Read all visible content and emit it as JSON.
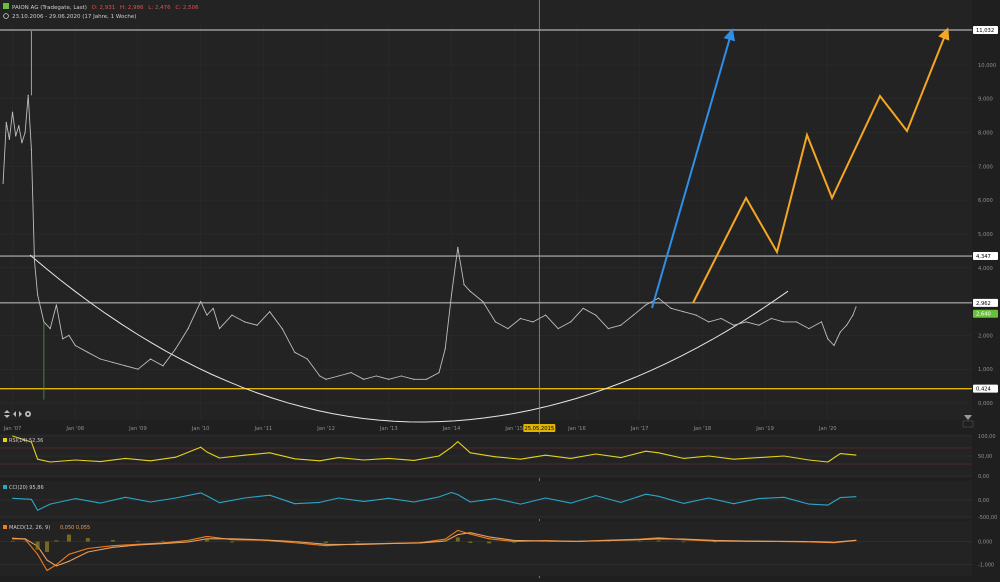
{
  "header": {
    "title_line1": "PAION AG (Tradegate, Last)",
    "o_label": "O: 2,931",
    "h_label": "H: 2,986",
    "l_label": "L: 2,476",
    "c_label": "C: 2,506",
    "title_line2": "23.10.2006 - 29.06.2020 (17 Jahre, 1 Woche)"
  },
  "colors": {
    "background": "#1f1f1f",
    "panel": "#232323",
    "grid": "#2e2e2e",
    "price": "#bdbdbd",
    "cursor": "#c9a227",
    "support": "#e0b400",
    "resistance": "#9a9a9a",
    "bowl": "#e8e8e8",
    "blue_arrow": "#2f8fe8",
    "orange_arrow": "#f5a623",
    "rsi": "#e6d21a",
    "cci": "#2aa6c9",
    "macd": "#f07c1c",
    "signal": "#e8a060",
    "histogram": "#8a7a20",
    "last_price_tag": "#6abf3a"
  },
  "chart_data": [
    {
      "type": "line",
      "name": "price",
      "ylim": [
        0,
        11.5
      ],
      "y_ticks": [
        0,
        1,
        2,
        3,
        4,
        5,
        6,
        7,
        8,
        9,
        10
      ],
      "y_tick_labels": [
        "0,000",
        "1,000",
        "2,000",
        "3,000",
        "4,000",
        "5,000",
        "6,000",
        "7,000",
        "8,000",
        "9,000",
        "10,000"
      ],
      "x_range": [
        2006.8,
        2022.3
      ],
      "x_ticks": [
        2007,
        2008,
        2009,
        2010,
        2011,
        2012,
        2013,
        2014,
        2015,
        2016,
        2017,
        2018,
        2019,
        2020
      ],
      "x_tick_labels": [
        "Jan '07",
        "Jan '08",
        "Jan '09",
        "Jan '10",
        "Jan '11",
        "Jan '12",
        "Jan '13",
        "Jan '14",
        "Jan '15",
        "Jan '16",
        "Jan '17",
        "Jan '18",
        "Jan '19",
        "Jan '20"
      ],
      "series": [
        {
          "x": [
            2006.85,
            2006.9,
            2006.95,
            2007.0,
            2007.05,
            2007.1,
            2007.15,
            2007.2,
            2007.25,
            2007.3,
            2007.35,
            2007.4,
            2007.5,
            2007.6,
            2007.7,
            2007.8,
            2007.9,
            2008.0,
            2008.2,
            2008.4,
            2008.6,
            2008.8,
            2009.0,
            2009.2,
            2009.4,
            2009.6,
            2009.8,
            2010.0,
            2010.1,
            2010.2,
            2010.3,
            2010.5,
            2010.7,
            2010.9,
            2011.1,
            2011.3,
            2011.5,
            2011.7,
            2011.9,
            2012.0,
            2012.2,
            2012.4,
            2012.6,
            2012.8,
            2013.0,
            2013.2,
            2013.4,
            2013.6,
            2013.8,
            2013.9,
            2014.0,
            2014.1,
            2014.2,
            2014.3,
            2014.5,
            2014.7,
            2014.9,
            2015.1,
            2015.3,
            2015.5,
            2015.7,
            2015.9,
            2016.1,
            2016.3,
            2016.5,
            2016.7,
            2016.9,
            2017.1,
            2017.3,
            2017.5,
            2017.7,
            2017.9,
            2018.1,
            2018.3,
            2018.5,
            2018.7,
            2018.9,
            2019.1,
            2019.3,
            2019.5,
            2019.7,
            2019.9,
            2020.0,
            2020.1,
            2020.2,
            2020.3,
            2020.4,
            2020.45
          ],
          "y": [
            6.5,
            8.3,
            7.8,
            8.6,
            7.9,
            8.2,
            7.7,
            8.0,
            9.1,
            7.5,
            4.2,
            3.2,
            2.4,
            2.2,
            2.9,
            1.9,
            2.0,
            1.7,
            1.5,
            1.3,
            1.2,
            1.1,
            1.0,
            1.3,
            1.1,
            1.6,
            2.2,
            3.0,
            2.6,
            2.8,
            2.2,
            2.6,
            2.4,
            2.3,
            2.7,
            2.2,
            1.5,
            1.3,
            0.8,
            0.7,
            0.8,
            0.9,
            0.7,
            0.8,
            0.7,
            0.8,
            0.7,
            0.7,
            0.9,
            1.6,
            3.2,
            4.6,
            3.5,
            3.3,
            3.0,
            2.4,
            2.2,
            2.5,
            2.4,
            2.6,
            2.2,
            2.4,
            2.8,
            2.6,
            2.2,
            2.3,
            2.6,
            2.9,
            3.1,
            2.8,
            2.7,
            2.6,
            2.4,
            2.5,
            2.3,
            2.4,
            2.3,
            2.5,
            2.4,
            2.4,
            2.2,
            2.4,
            1.9,
            1.7,
            2.1,
            2.3,
            2.6,
            2.84
          ]
        }
      ],
      "horizontal_lines": [
        {
          "value": 11.032,
          "label": "11,032"
        },
        {
          "value": 4.347,
          "label": "4,347"
        },
        {
          "value": 2.962,
          "label": "2,962"
        },
        {
          "value": 0.424,
          "label": "0,424"
        }
      ],
      "last_value": {
        "value": 2.64,
        "label": "2,640"
      },
      "cursor": {
        "x": 2015.4,
        "label": "25.05.2015"
      }
    },
    {
      "type": "line",
      "name": "RSI(14) 52,36",
      "ylim": [
        0,
        100
      ],
      "y_ticks": [
        0,
        50,
        100
      ],
      "y_tick_labels": [
        "0,00",
        "50,00",
        "100,00"
      ],
      "reference_lines": [
        30,
        70
      ],
      "x_range": [
        2006.8,
        2022.3
      ],
      "series": [
        {
          "x": [
            2007.0,
            2007.3,
            2007.4,
            2007.6,
            2008.0,
            2008.4,
            2008.8,
            2009.2,
            2009.6,
            2010.0,
            2010.1,
            2010.3,
            2010.7,
            2011.1,
            2011.5,
            2011.9,
            2012.2,
            2012.6,
            2013.0,
            2013.4,
            2013.8,
            2014.0,
            2014.1,
            2014.3,
            2014.7,
            2015.1,
            2015.5,
            2015.9,
            2016.3,
            2016.7,
            2017.1,
            2017.3,
            2017.7,
            2018.1,
            2018.5,
            2018.9,
            2019.3,
            2019.7,
            2020.0,
            2020.2,
            2020.45
          ],
          "y": [
            100,
            85,
            42,
            35,
            40,
            36,
            44,
            38,
            47,
            72,
            60,
            45,
            52,
            58,
            43,
            38,
            46,
            40,
            44,
            39,
            50,
            72,
            86,
            58,
            48,
            42,
            52,
            44,
            55,
            46,
            62,
            58,
            44,
            50,
            42,
            46,
            50,
            40,
            35,
            56,
            52.36
          ]
        }
      ]
    },
    {
      "type": "line",
      "name": "CCI(20) 95,86",
      "ylim": [
        -500,
        500
      ],
      "y_ticks": [
        -500,
        0
      ],
      "y_tick_labels": [
        "-500,00",
        "0,00"
      ],
      "x_range": [
        2006.8,
        2022.3
      ],
      "series": [
        {
          "x": [
            2007.0,
            2007.3,
            2007.4,
            2007.6,
            2008.0,
            2008.4,
            2008.8,
            2009.2,
            2009.6,
            2010.0,
            2010.1,
            2010.3,
            2010.7,
            2011.1,
            2011.5,
            2011.9,
            2012.2,
            2012.6,
            2013.0,
            2013.4,
            2013.8,
            2014.0,
            2014.1,
            2014.3,
            2014.7,
            2015.1,
            2015.5,
            2015.9,
            2016.3,
            2016.7,
            2017.1,
            2017.3,
            2017.7,
            2018.1,
            2018.5,
            2018.9,
            2019.3,
            2019.7,
            2020.0,
            2020.2,
            2020.45
          ],
          "y": [
            50,
            20,
            -300,
            -120,
            40,
            -90,
            80,
            -60,
            60,
            210,
            120,
            -80,
            60,
            140,
            -110,
            -70,
            60,
            -40,
            50,
            -60,
            90,
            220,
            160,
            -60,
            40,
            -120,
            60,
            -90,
            130,
            -70,
            170,
            110,
            -100,
            60,
            -110,
            40,
            80,
            -120,
            -150,
            70,
            95.86
          ]
        }
      ]
    },
    {
      "type": "line",
      "name": "MACD(12, 26, 9)",
      "legend_values": "0,050  0,055",
      "ylim": [
        -1.4,
        0.8
      ],
      "y_ticks": [
        -1.0,
        0.0
      ],
      "y_tick_labels": [
        "-1,000",
        "0,000"
      ],
      "x_range": [
        2006.8,
        2022.3
      ],
      "series": [
        {
          "name": "macd",
          "x": [
            2007.0,
            2007.2,
            2007.4,
            2007.55,
            2007.7,
            2007.9,
            2008.2,
            2008.6,
            2009.0,
            2009.4,
            2009.8,
            2010.1,
            2010.5,
            2011.0,
            2011.5,
            2012.0,
            2012.5,
            2013.0,
            2013.5,
            2013.9,
            2014.1,
            2014.3,
            2014.6,
            2015.0,
            2015.5,
            2016.0,
            2016.5,
            2017.0,
            2017.3,
            2017.7,
            2018.2,
            2018.7,
            2019.2,
            2019.7,
            2020.1,
            2020.45
          ],
          "y": [
            0.15,
            0.1,
            -0.55,
            -1.25,
            -1.0,
            -0.55,
            -0.3,
            -0.18,
            -0.12,
            -0.06,
            0.05,
            0.22,
            0.08,
            0.06,
            -0.05,
            -0.18,
            -0.1,
            -0.08,
            -0.05,
            0.1,
            0.48,
            0.32,
            0.12,
            0.0,
            0.04,
            0.0,
            0.06,
            0.1,
            0.16,
            0.08,
            0.02,
            0.01,
            0.0,
            -0.02,
            -0.05,
            0.05
          ]
        },
        {
          "name": "signal",
          "x": [
            2007.0,
            2007.2,
            2007.4,
            2007.55,
            2007.7,
            2007.9,
            2008.2,
            2008.6,
            2009.0,
            2009.4,
            2009.8,
            2010.1,
            2010.5,
            2011.0,
            2011.5,
            2012.0,
            2012.5,
            2013.0,
            2013.5,
            2013.9,
            2014.1,
            2014.3,
            2014.6,
            2015.0,
            2015.5,
            2016.0,
            2016.5,
            2017.0,
            2017.3,
            2017.7,
            2018.2,
            2018.7,
            2019.2,
            2019.7,
            2020.1,
            2020.45
          ],
          "y": [
            0.12,
            0.12,
            -0.2,
            -0.8,
            -1.05,
            -0.85,
            -0.45,
            -0.25,
            -0.15,
            -0.09,
            -0.02,
            0.12,
            0.12,
            0.07,
            0.0,
            -0.12,
            -0.13,
            -0.09,
            -0.06,
            0.02,
            0.3,
            0.38,
            0.2,
            0.05,
            0.02,
            0.01,
            0.04,
            0.08,
            0.12,
            0.11,
            0.05,
            0.02,
            0.01,
            0.0,
            -0.03,
            0.055
          ]
        }
      ]
    }
  ]
}
